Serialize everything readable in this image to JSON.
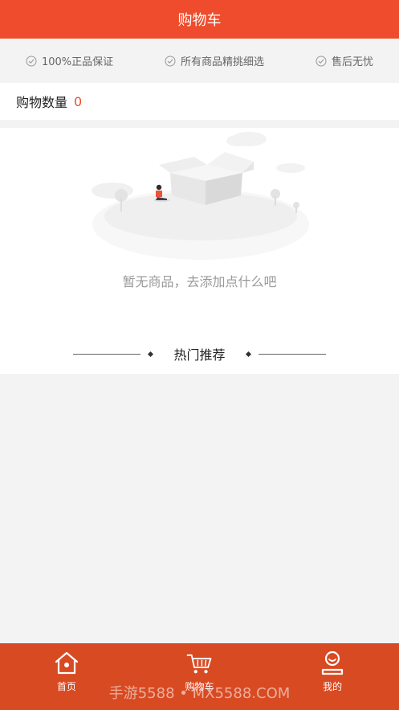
{
  "header": {
    "title": "购物车"
  },
  "guarantees": [
    {
      "label": "100%正品保证",
      "icon": "check-circle-icon"
    },
    {
      "label": "所有商品精挑细选",
      "icon": "check-circle-icon"
    },
    {
      "label": "售后无忧",
      "icon": "check-circle-icon"
    }
  ],
  "cart": {
    "count_label": "购物数量",
    "count_value": "0"
  },
  "empty": {
    "message": "暂无商品，去添加点什么吧"
  },
  "recommend": {
    "title": "热门推荐"
  },
  "tabbar": {
    "items": [
      {
        "label": "首页",
        "icon": "home-icon"
      },
      {
        "label": "购物车",
        "icon": "cart-icon"
      },
      {
        "label": "我的",
        "icon": "user-icon"
      }
    ]
  },
  "watermark": "手游5588 • MX5588.COM",
  "colors": {
    "brand": "#ee4c2d",
    "tabbar": "#d84a22",
    "background": "#f4f3f4"
  }
}
